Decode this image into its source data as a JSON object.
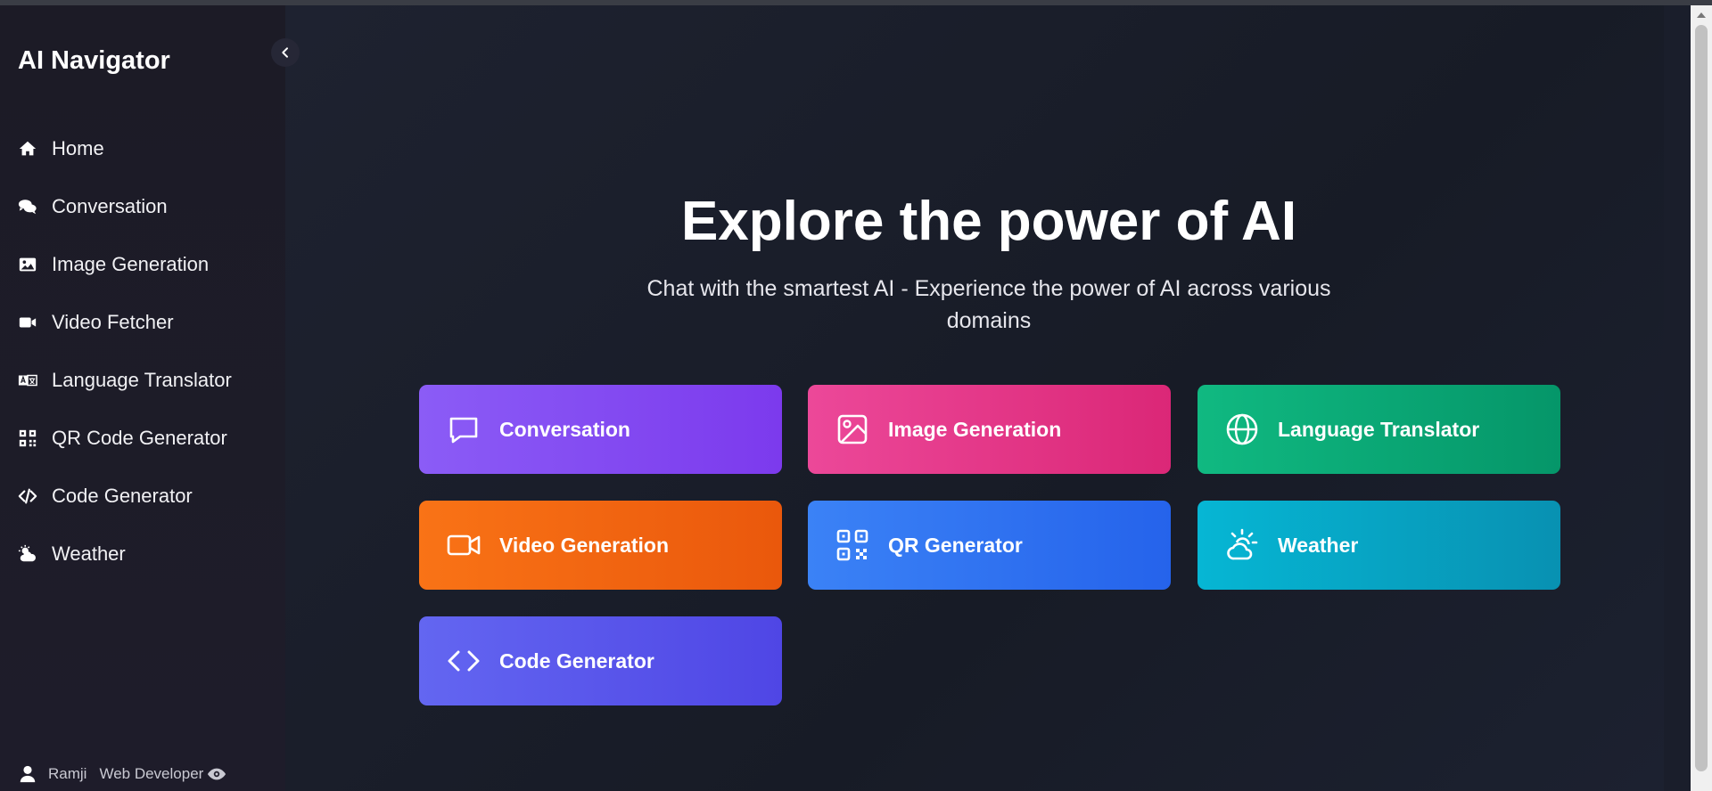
{
  "app": {
    "title": "AI Navigator"
  },
  "sidebar": {
    "items": [
      {
        "label": "Home",
        "icon": "home-icon"
      },
      {
        "label": "Conversation",
        "icon": "comments-icon"
      },
      {
        "label": "Image Generation",
        "icon": "image-icon"
      },
      {
        "label": "Video Fetcher",
        "icon": "video-icon"
      },
      {
        "label": "Language Translator",
        "icon": "translate-icon"
      },
      {
        "label": "QR Code Generator",
        "icon": "qrcode-icon"
      },
      {
        "label": "Code Generator",
        "icon": "code-icon"
      },
      {
        "label": "Weather",
        "icon": "cloud-sun-icon"
      }
    ],
    "user": {
      "name": "Ramji",
      "role": "Web Developer"
    }
  },
  "hero": {
    "title": "Explore the power of AI",
    "subtitle": "Chat with the smartest AI - Experience the power of AI across various domains"
  },
  "cards": [
    {
      "label": "Conversation",
      "icon": "message-square-icon",
      "color": "#8b5cf6"
    },
    {
      "label": "Image Generation",
      "icon": "image-icon",
      "color": "#ec4899"
    },
    {
      "label": "Language Translator",
      "icon": "globe-icon",
      "color": "#10b981"
    },
    {
      "label": "Video Generation",
      "icon": "video-icon",
      "color": "#f97316"
    },
    {
      "label": "QR Generator",
      "icon": "qrcode-icon",
      "color": "#3b82f6"
    },
    {
      "label": "Weather",
      "icon": "cloud-sun-icon",
      "color": "#06b6d4"
    },
    {
      "label": "Code Generator",
      "icon": "code-icon",
      "color": "#6366f1"
    }
  ]
}
